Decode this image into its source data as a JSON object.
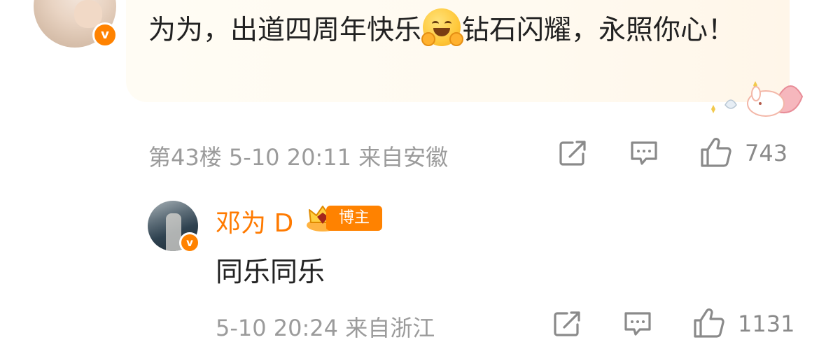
{
  "comment": {
    "text_part1": "为为，出道四周年快乐",
    "emoji": "hugging-face",
    "text_part2": "钻石闪耀，永照你心！",
    "floor": "第43楼",
    "date": "5-10",
    "time": "20:11",
    "location": "来自安徽",
    "likes": "743"
  },
  "reply": {
    "username": "邓为 D",
    "badge": "博主",
    "text": "同乐同乐",
    "date": "5-10",
    "time": "20:24",
    "location": "来自浙江",
    "likes": "1131"
  },
  "colors": {
    "accent": "#ff8200",
    "meta": "#9b9b9b",
    "bubble": "#fffaf0"
  },
  "icons": [
    "share-icon",
    "comment-icon",
    "like-icon",
    "verified-icon",
    "crown-badge-icon"
  ]
}
